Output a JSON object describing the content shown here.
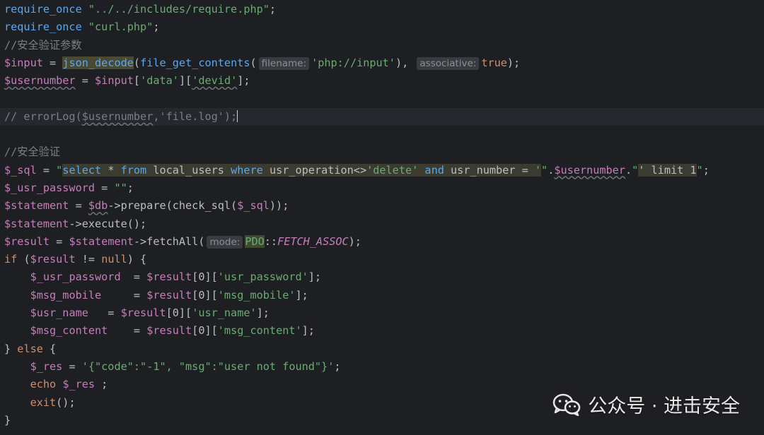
{
  "editor": {
    "theme_colors": {
      "background": "#1e1f22",
      "keyword": "#cf8e6d",
      "string": "#6aab73",
      "variable": "#c77dbb",
      "function": "#56a8f5",
      "comment": "#7a7e85",
      "plain": "#bcbec4"
    },
    "lines": [
      [
        {
          "text": "require_once",
          "cls": "t-fn"
        },
        {
          "text": " ",
          "cls": "t-plain"
        },
        {
          "text": "\"../../includes/require.php\"",
          "cls": "t-str"
        },
        {
          "text": ";",
          "cls": "t-plain"
        }
      ],
      [
        {
          "text": "require_once",
          "cls": "t-fn"
        },
        {
          "text": " ",
          "cls": "t-plain"
        },
        {
          "text": "\"curl.php\"",
          "cls": "t-str"
        },
        {
          "text": ";",
          "cls": "t-plain"
        }
      ],
      [
        {
          "text": "//安全验证参数",
          "cls": "t-com"
        }
      ],
      [
        {
          "text": "$input",
          "cls": "t-var"
        },
        {
          "text": " = ",
          "cls": "t-plain"
        },
        {
          "text": "json_decode",
          "cls": "t-fn t-hlfn"
        },
        {
          "text": "(",
          "cls": "t-plain"
        },
        {
          "text": "file_get_contents",
          "cls": "t-fn"
        },
        {
          "text": "(",
          "cls": "t-plain"
        },
        {
          "text": "filename:",
          "cls": "t-hint"
        },
        {
          "text": "'php://input'",
          "cls": "t-str"
        },
        {
          "text": "), ",
          "cls": "t-plain"
        },
        {
          "text": "associative:",
          "cls": "t-hint"
        },
        {
          "text": "true",
          "cls": "t-kw"
        },
        {
          "text": ");",
          "cls": "t-plain"
        }
      ],
      [
        {
          "text": "$usernumber",
          "cls": "t-var t-warn"
        },
        {
          "text": " = ",
          "cls": "t-plain"
        },
        {
          "text": "$input",
          "cls": "t-var"
        },
        {
          "text": "[",
          "cls": "t-plain"
        },
        {
          "text": "'data'",
          "cls": "t-str"
        },
        {
          "text": "][",
          "cls": "t-plain"
        },
        {
          "text": "'devid'",
          "cls": "t-str t-warn"
        },
        {
          "text": "];",
          "cls": "t-plain"
        }
      ],
      [],
      [
        {
          "text": "// errorLog(",
          "cls": "t-com"
        },
        {
          "text": "$usernumber",
          "cls": "t-com t-warn"
        },
        {
          "text": ",'file.log');",
          "cls": "t-com"
        },
        {
          "text": "",
          "cls": "caret"
        }
      ],
      [],
      [
        {
          "text": "//安全验证",
          "cls": "t-com"
        }
      ],
      [
        {
          "text": "$_sql",
          "cls": "t-var"
        },
        {
          "text": " = ",
          "cls": "t-plain"
        },
        {
          "text": "\"",
          "cls": "t-str"
        },
        {
          "text": "select",
          "cls": "t-fn t-hl"
        },
        {
          "text": " * ",
          "cls": "t-plain t-hl"
        },
        {
          "text": "from",
          "cls": "t-fn t-hl"
        },
        {
          "text": " local_users ",
          "cls": "t-plain t-hl"
        },
        {
          "text": "where",
          "cls": "t-fn t-hl"
        },
        {
          "text": " usr_operation<>",
          "cls": "t-plain t-hl"
        },
        {
          "text": "'delete'",
          "cls": "t-str t-hl"
        },
        {
          "text": " ",
          "cls": "t-plain t-hl"
        },
        {
          "text": "and",
          "cls": "t-fn t-hl"
        },
        {
          "text": " usr_number = ",
          "cls": "t-plain t-hl"
        },
        {
          "text": "'",
          "cls": "t-str t-hl"
        },
        {
          "text": "\"",
          "cls": "t-str"
        },
        {
          "text": ".",
          "cls": "t-plain"
        },
        {
          "text": "$usernumber",
          "cls": "t-var t-warn"
        },
        {
          "text": ".",
          "cls": "t-plain"
        },
        {
          "text": "\"",
          "cls": "t-str"
        },
        {
          "text": "' limit 1",
          "cls": "t-plain t-hl"
        },
        {
          "text": "\"",
          "cls": "t-str"
        },
        {
          "text": ";",
          "cls": "t-plain"
        }
      ],
      [
        {
          "text": "$_usr_password",
          "cls": "t-var"
        },
        {
          "text": " = ",
          "cls": "t-plain"
        },
        {
          "text": "\"\"",
          "cls": "t-str"
        },
        {
          "text": ";",
          "cls": "t-plain"
        }
      ],
      [
        {
          "text": "$statement",
          "cls": "t-var"
        },
        {
          "text": " = ",
          "cls": "t-plain"
        },
        {
          "text": "$db",
          "cls": "t-var t-warn"
        },
        {
          "text": "->prepare(check_sql(",
          "cls": "t-plain"
        },
        {
          "text": "$_sql",
          "cls": "t-var"
        },
        {
          "text": "));",
          "cls": "t-plain"
        }
      ],
      [
        {
          "text": "$statement",
          "cls": "t-var"
        },
        {
          "text": "->execute();",
          "cls": "t-plain"
        }
      ],
      [
        {
          "text": "$result",
          "cls": "t-var"
        },
        {
          "text": " = ",
          "cls": "t-plain"
        },
        {
          "text": "$statement",
          "cls": "t-var"
        },
        {
          "text": "->fetchAll(",
          "cls": "t-plain"
        },
        {
          "text": "mode:",
          "cls": "t-hint"
        },
        {
          "text": "PDO",
          "cls": "t-str t-hlpdo"
        },
        {
          "text": "::",
          "cls": "t-plain"
        },
        {
          "text": "FETCH_ASSOC",
          "cls": "t-const"
        },
        {
          "text": ");",
          "cls": "t-plain"
        }
      ],
      [
        {
          "text": "if",
          "cls": "t-kw"
        },
        {
          "text": " (",
          "cls": "t-plain"
        },
        {
          "text": "$result",
          "cls": "t-var"
        },
        {
          "text": " != ",
          "cls": "t-plain"
        },
        {
          "text": "null",
          "cls": "t-kw"
        },
        {
          "text": ") {",
          "cls": "t-plain"
        }
      ],
      [
        {
          "text": "    ",
          "cls": "t-plain"
        },
        {
          "text": "$_usr_password",
          "cls": "t-var"
        },
        {
          "text": "  = ",
          "cls": "t-plain"
        },
        {
          "text": "$result",
          "cls": "t-var"
        },
        {
          "text": "[0][",
          "cls": "t-plain"
        },
        {
          "text": "'usr_password'",
          "cls": "t-str"
        },
        {
          "text": "];",
          "cls": "t-plain"
        }
      ],
      [
        {
          "text": "    ",
          "cls": "t-plain"
        },
        {
          "text": "$msg_mobile",
          "cls": "t-var"
        },
        {
          "text": "     = ",
          "cls": "t-plain"
        },
        {
          "text": "$result",
          "cls": "t-var"
        },
        {
          "text": "[0][",
          "cls": "t-plain"
        },
        {
          "text": "'msg_mobile'",
          "cls": "t-str"
        },
        {
          "text": "];",
          "cls": "t-plain"
        }
      ],
      [
        {
          "text": "    ",
          "cls": "t-plain"
        },
        {
          "text": "$usr_name",
          "cls": "t-var"
        },
        {
          "text": "   = ",
          "cls": "t-plain"
        },
        {
          "text": "$result",
          "cls": "t-var"
        },
        {
          "text": "[0][",
          "cls": "t-plain"
        },
        {
          "text": "'usr_name'",
          "cls": "t-str"
        },
        {
          "text": "];",
          "cls": "t-plain"
        }
      ],
      [
        {
          "text": "    ",
          "cls": "t-plain"
        },
        {
          "text": "$msg_content",
          "cls": "t-var"
        },
        {
          "text": "    = ",
          "cls": "t-plain"
        },
        {
          "text": "$result",
          "cls": "t-var"
        },
        {
          "text": "[0][",
          "cls": "t-plain"
        },
        {
          "text": "'msg_content'",
          "cls": "t-str"
        },
        {
          "text": "];",
          "cls": "t-plain"
        }
      ],
      [
        {
          "text": "} ",
          "cls": "t-plain"
        },
        {
          "text": "else",
          "cls": "t-kw"
        },
        {
          "text": " {",
          "cls": "t-plain"
        }
      ],
      [
        {
          "text": "    ",
          "cls": "t-plain"
        },
        {
          "text": "$_res",
          "cls": "t-var"
        },
        {
          "text": " = ",
          "cls": "t-plain"
        },
        {
          "text": "'{\"code\":\"-1\", \"msg\":\"user not found\"}'",
          "cls": "t-str"
        },
        {
          "text": ";",
          "cls": "t-plain"
        }
      ],
      [
        {
          "text": "    ",
          "cls": "t-plain"
        },
        {
          "text": "echo",
          "cls": "t-kw"
        },
        {
          "text": " ",
          "cls": "t-plain"
        },
        {
          "text": "$_res",
          "cls": "t-var"
        },
        {
          "text": " ;",
          "cls": "t-plain"
        }
      ],
      [
        {
          "text": "    ",
          "cls": "t-plain"
        },
        {
          "text": "exit",
          "cls": "t-kw"
        },
        {
          "text": "();",
          "cls": "t-plain"
        }
      ],
      [
        {
          "text": "}",
          "cls": "t-plain"
        }
      ]
    ]
  },
  "watermark": {
    "icon": "wechat-icon",
    "text": "公众号 · 进击安全"
  }
}
